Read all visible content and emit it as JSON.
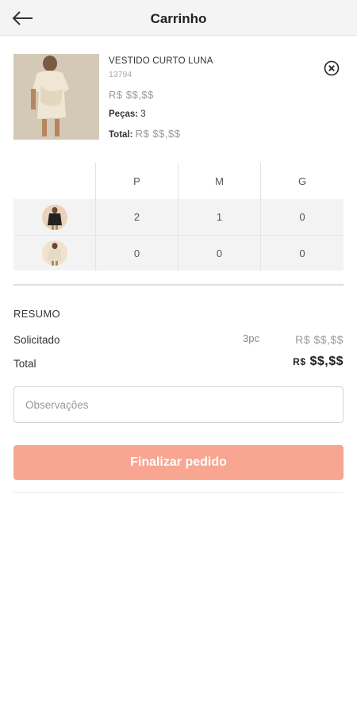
{
  "header": {
    "title": "Carrinho",
    "back_icon": "arrow-left-icon"
  },
  "product": {
    "name": "VESTIDO CURTO LUNA",
    "sku": "13794",
    "price": "R$ $$,$$",
    "pieces_label": "Peças:",
    "pieces_value": "3",
    "total_label": "Total:",
    "total_value": "R$ $$,$$",
    "remove_icon": "close-circle-icon",
    "image_color": "#e4dcc9"
  },
  "grid": {
    "sizes": [
      "P",
      "M",
      "G"
    ],
    "rows": [
      {
        "swatch": "black-dress-swatch",
        "color": "#222222",
        "quantities": [
          "2",
          "1",
          "0"
        ]
      },
      {
        "swatch": "beige-dress-swatch",
        "color": "#e4dcc9",
        "quantities": [
          "0",
          "0",
          "0"
        ]
      }
    ]
  },
  "summary": {
    "title": "RESUMO",
    "requested_label": "Solicitado",
    "requested_qty": "3pc",
    "requested_value": "R$ $$,$$",
    "total_label": "Total",
    "total_currency": "R$",
    "total_value": "$$,$$"
  },
  "observations": {
    "placeholder": "Observações",
    "value": ""
  },
  "finalize": {
    "label": "Finalizar pedido",
    "color": "#f8a592"
  }
}
